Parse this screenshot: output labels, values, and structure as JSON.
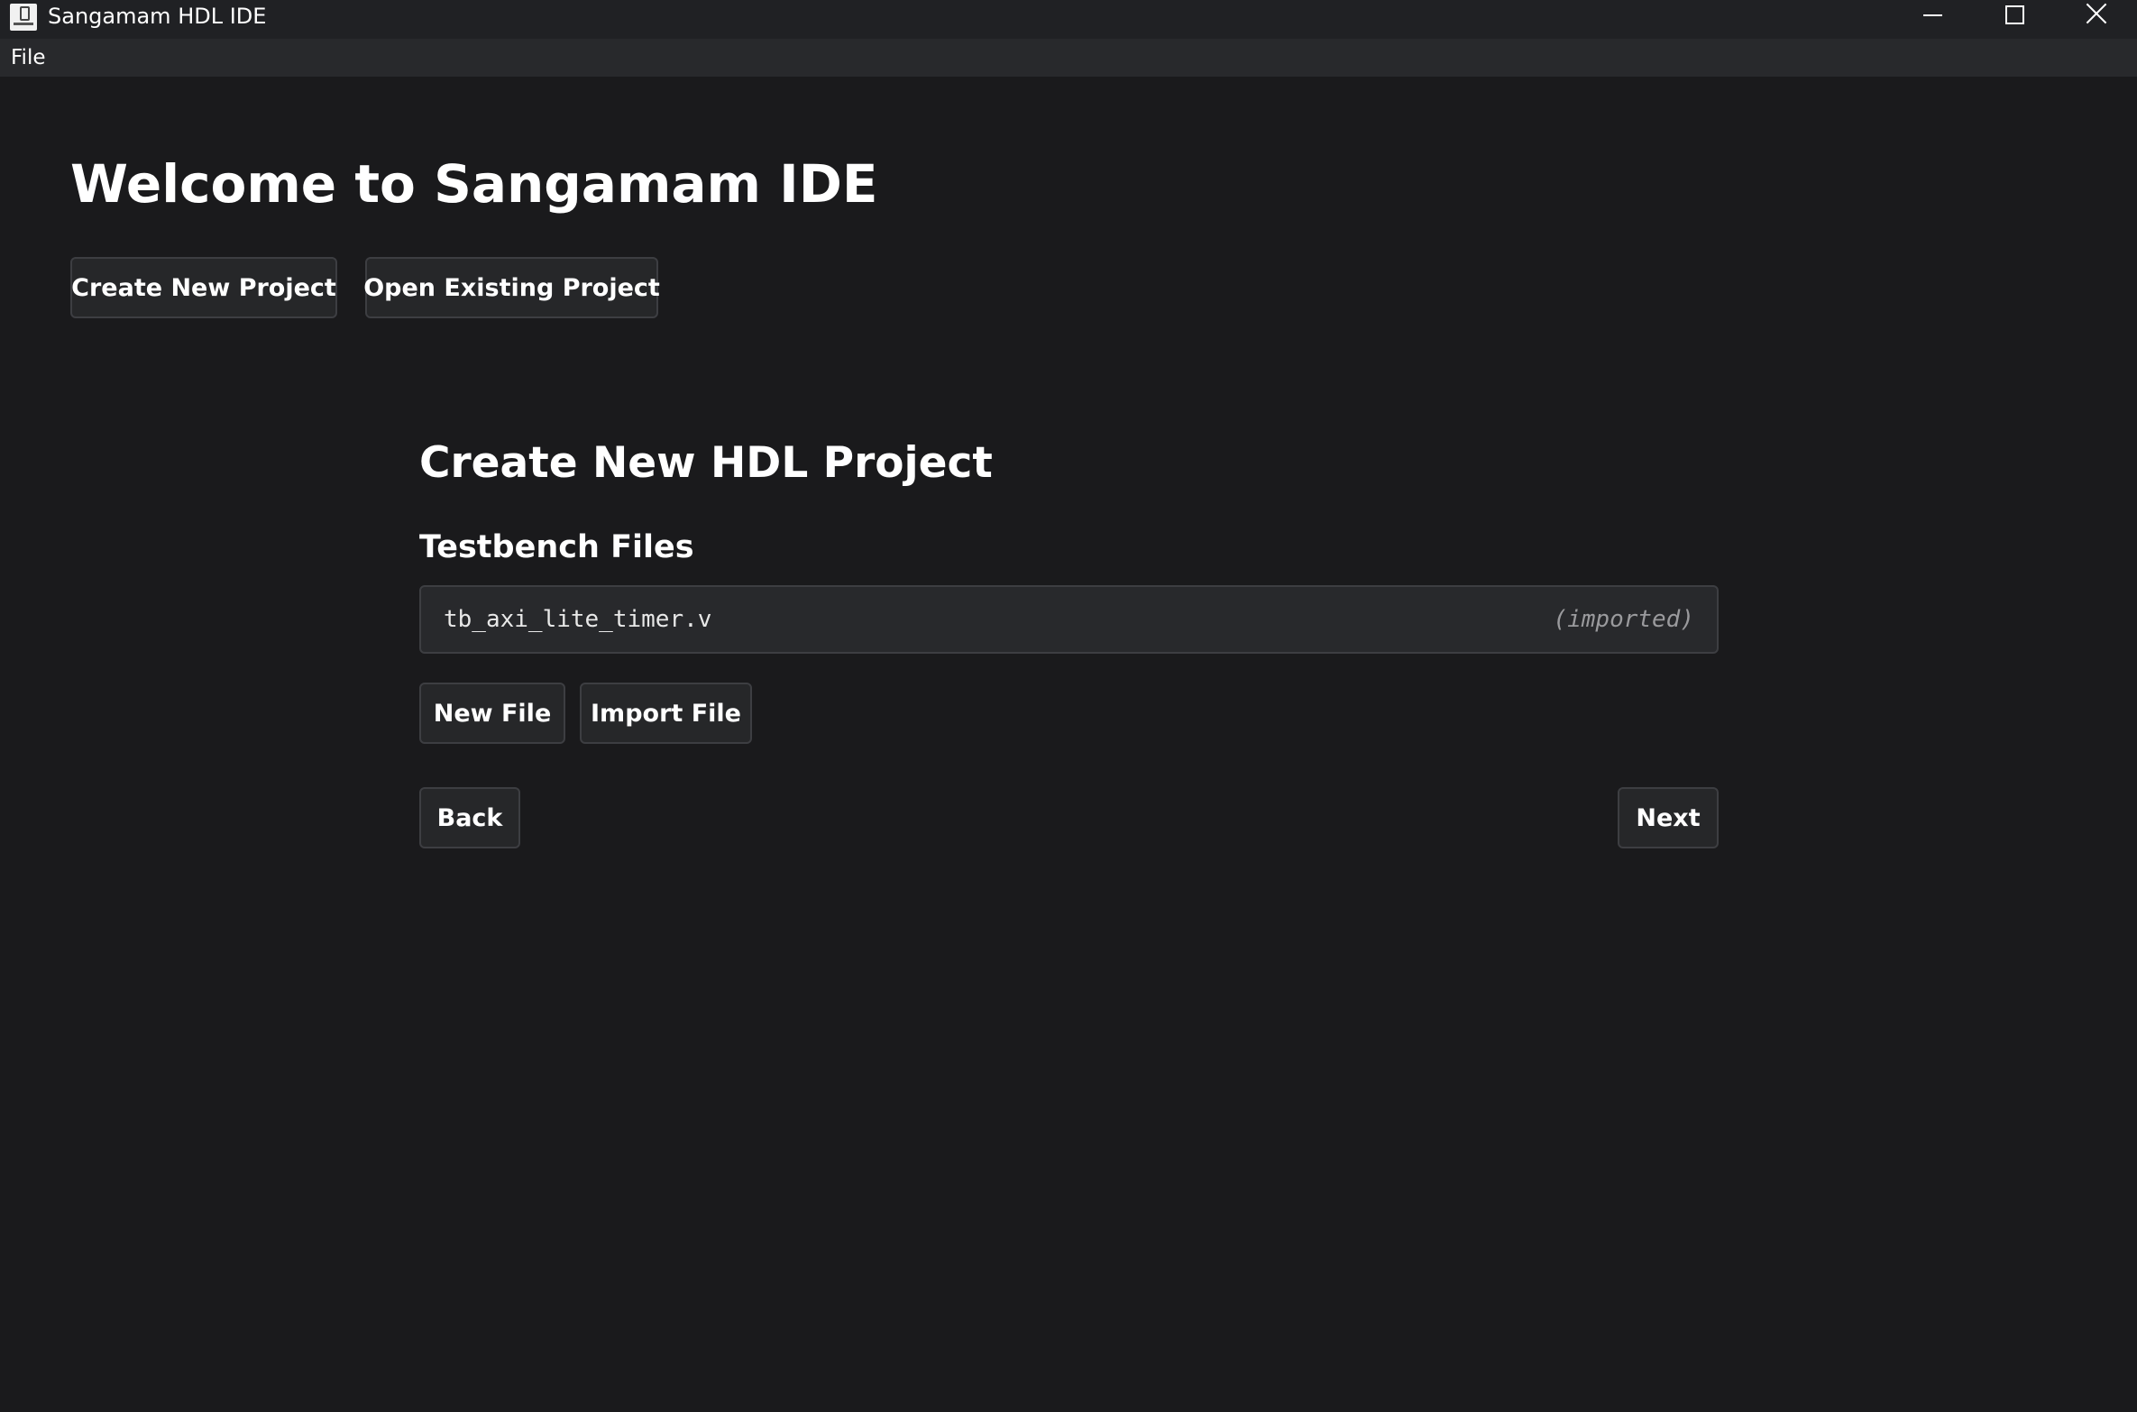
{
  "window": {
    "title": "Sangamam HDL IDE",
    "icon": "app-icon"
  },
  "menubar": {
    "items": [
      "File"
    ]
  },
  "welcome": {
    "title": "Welcome to Sangamam IDE",
    "create_new_label": "Create New Project",
    "open_existing_label": "Open Existing Project"
  },
  "wizard": {
    "title": "Create New HDL Project",
    "section_title": "Testbench Files",
    "files": [
      {
        "name": "tb_axi_lite_timer.v",
        "status": "(imported)"
      }
    ],
    "new_file_label": "New File",
    "import_file_label": "Import File",
    "back_label": "Back",
    "next_label": "Next"
  },
  "colors": {
    "background": "#1a1a1c",
    "titlebar": "#202124",
    "menubar": "#28292c",
    "button_bg": "#262729",
    "button_border": "#3d3e42",
    "text": "#ffffff",
    "muted_text": "#9a9a9d"
  }
}
